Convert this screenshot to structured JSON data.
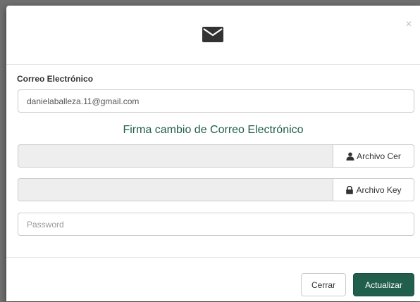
{
  "modal": {
    "close_label": "×",
    "header_icon": "envelope-icon"
  },
  "form": {
    "email_label": "Correo Electrónico",
    "email_value": "danielaballeza.11@gmail.com",
    "section_title": "Firma cambio de Correo Electrónico",
    "cer_button_label": "Archivo Cer",
    "cer_button_icon": "user-icon",
    "key_button_label": "Archivo Key",
    "key_button_icon": "lock-icon",
    "password_placeholder": "Password"
  },
  "footer": {
    "cancel_label": "Cerrar",
    "submit_label": "Actualizar"
  },
  "colors": {
    "accent": "#215f4c",
    "backdrop": "#6f6f6f"
  }
}
